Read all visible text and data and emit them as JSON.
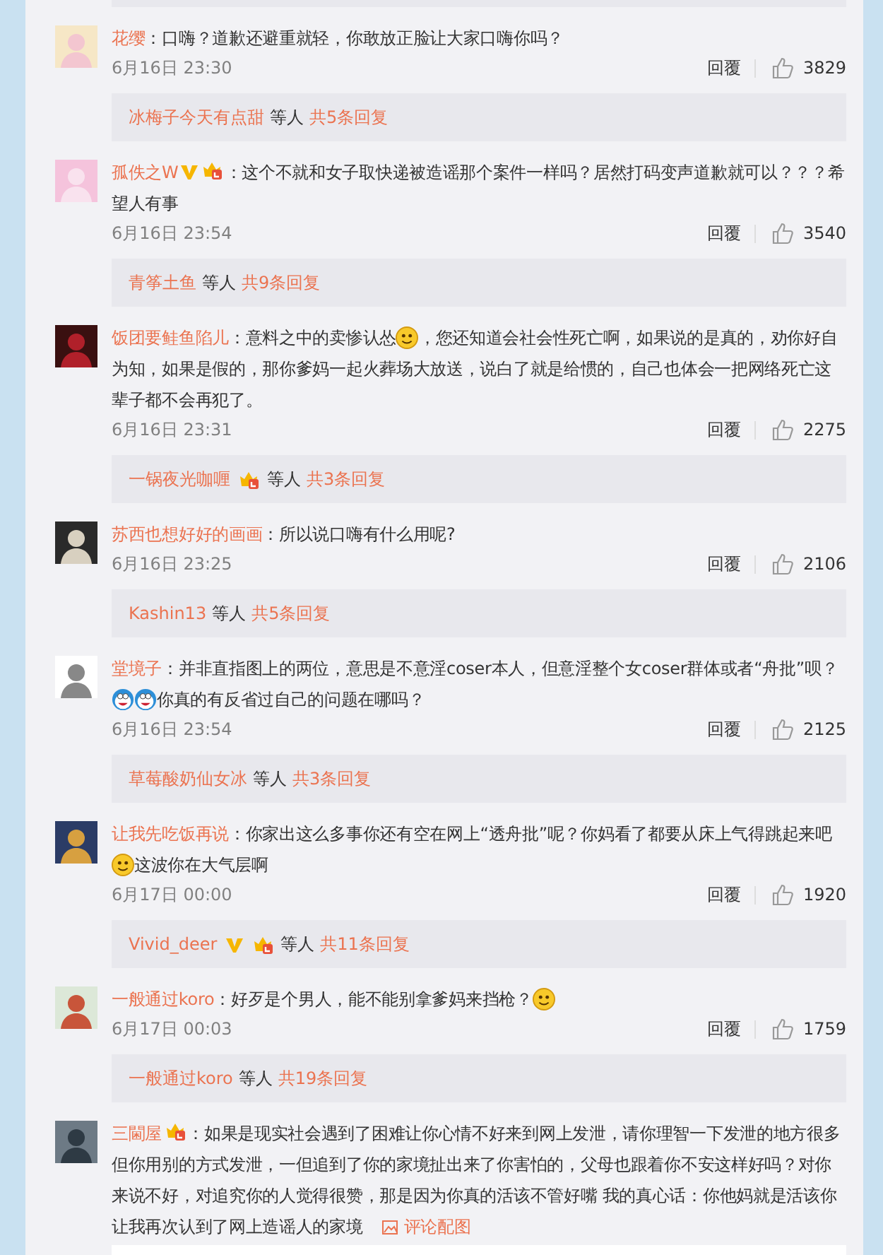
{
  "comments": [
    {
      "user": "花缨",
      "content": [
        {
          "kind": "text",
          "text": "：口嗨？道歉还避重就轻，你敢放正脸让大家口嗨你吗？"
        }
      ],
      "date": "6月16日 23:30",
      "reply_action": "回覆",
      "likes": "3829",
      "replies": {
        "user": "冰梅子今天有点甜",
        "suffix": "等人",
        "count": "共5条回复"
      }
    },
    {
      "user": "孤佚之W",
      "badges": [
        {
          "kind": "verified"
        },
        {
          "kind": "member"
        }
      ],
      "content": [
        {
          "kind": "text",
          "text": "：这个不就和女子取快递被造谣那个案件一样吗？居然打码变声道歉就可以？？？希望人有事"
        }
      ],
      "date": "6月16日 23:54",
      "reply_action": "回覆",
      "likes": "3540",
      "replies": {
        "user": "青筝土鱼",
        "suffix": "等人",
        "count": "共9条回复"
      }
    },
    {
      "user": "饭团要鲑鱼陷儿",
      "content": [
        {
          "kind": "text",
          "text": "：意料之中的卖惨认怂"
        },
        {
          "kind": "emoji"
        },
        {
          "kind": "text",
          "text": "，您还知道会社会性死亡啊，如果说的是真的，劝你好自为知，如果是假的，那你爹妈一起火葬场大放送，说白了就是给惯的，自己也体会一把网络死亡这辈子都不会再犯了。"
        }
      ],
      "date": "6月16日 23:31",
      "reply_action": "回覆",
      "likes": "2275",
      "replies": {
        "user": "一锅夜光咖喱",
        "badges": [
          {
            "kind": "member"
          }
        ],
        "suffix": "等人",
        "count": "共3条回复"
      }
    },
    {
      "user": "苏西也想好好的画画",
      "content": [
        {
          "kind": "text",
          "text": "：所以说口嗨有什么用呢?"
        }
      ],
      "date": "6月16日 23:25",
      "reply_action": "回覆",
      "likes": "2106",
      "replies": {
        "user": "Kashin13",
        "suffix": "等人",
        "count": "共5条回复"
      }
    },
    {
      "user": "堂境子",
      "content": [
        {
          "kind": "text",
          "text": "：并非直指图上的两位，意思是不意淫coser本人，但意淫整个女coser群体或者“舟批”呗？"
        },
        {
          "kind": "robot"
        },
        {
          "kind": "robot"
        },
        {
          "kind": "text",
          "text": "你真的有反省过自己的问题在哪吗？"
        }
      ],
      "date": "6月16日 23:54",
      "reply_action": "回覆",
      "likes": "2125",
      "replies": {
        "user": "草莓酸奶仙女冰",
        "suffix": "等人",
        "count": "共3条回复"
      }
    },
    {
      "user": "让我先吃饭再说",
      "content": [
        {
          "kind": "text",
          "text": "：你家出这么多事你还有空在网上“透舟批”呢？你妈看了都要从床上气得跳起来吧"
        },
        {
          "kind": "emoji"
        },
        {
          "kind": "text",
          "text": "这波你在大气层啊"
        }
      ],
      "date": "6月17日 00:00",
      "reply_action": "回覆",
      "likes": "1920",
      "replies": {
        "user": "Vivid_deer",
        "badges": [
          {
            "kind": "verified"
          },
          {
            "kind": "member"
          }
        ],
        "suffix": "等人",
        "count": "共11条回复"
      }
    },
    {
      "user": "一般通过koro",
      "content": [
        {
          "kind": "text",
          "text": "：好歹是个男人，能不能别拿爹妈来挡枪？"
        },
        {
          "kind": "emoji"
        }
      ],
      "date": "6月17日 00:03",
      "reply_action": "回覆",
      "likes": "1759",
      "replies": {
        "user": "一般通过koro",
        "suffix": "等人",
        "count": "共19条回复"
      }
    },
    {
      "user": "三閫屋",
      "badges": [
        {
          "kind": "member"
        }
      ],
      "content": [
        {
          "kind": "text",
          "text": "：如果是现实社会遇到了困难让你心情不好来到网上发泄，请你理智一下发泄的地方很多但你用别的方式发泄，一但追到了你的家境扯出来了你害怕的，父母也跟着你不安这样好吗？对你来说不好，对追究你的人觉得很赞，那是因为你真的活该不管好嘴 我的真心话：你他妈就是活该你让我再次认到了网上造谣人的家境"
        },
        {
          "kind": "image_link",
          "text": "评论配图"
        }
      ]
    }
  ]
}
